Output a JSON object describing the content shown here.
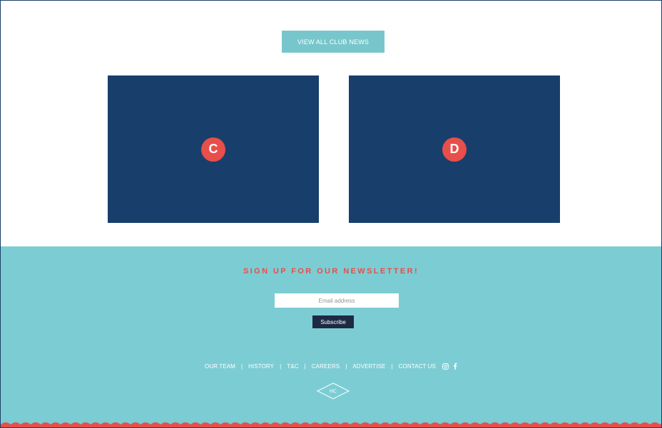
{
  "news": {
    "view_all_label": "VIEW ALL CLUB NEWS",
    "cards": [
      {
        "marker": "C"
      },
      {
        "marker": "D"
      }
    ]
  },
  "newsletter": {
    "title": "SIGN UP FOR OUR NEWSLETTER!",
    "email_placeholder": "Email address",
    "subscribe_label": "Subscribe"
  },
  "footer": {
    "nav": [
      "OUR TEAM",
      "HISTORY",
      "T&C",
      "CAREERS",
      "ADVERTISE",
      "CONTACT US"
    ],
    "separator": "|",
    "social_icons": [
      "instagram-icon",
      "facebook-icon"
    ],
    "logo_text": "HC"
  },
  "colors": {
    "navy": "#183f6c",
    "teal": "#7ccdd3",
    "button_teal": "#77c6cc",
    "accent_red": "#e84e4a",
    "dark_button": "#1e2a44"
  }
}
